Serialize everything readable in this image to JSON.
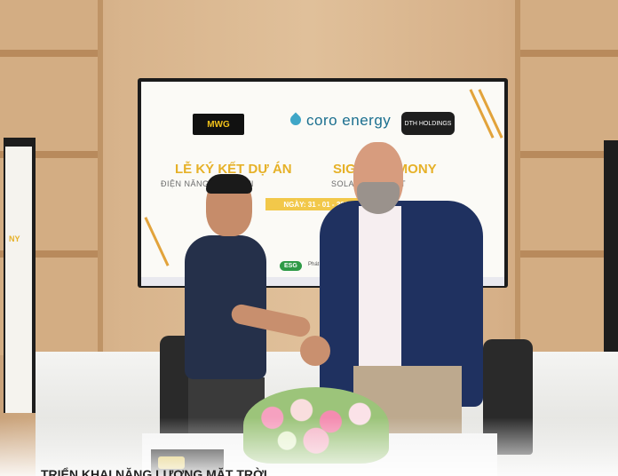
{
  "screen": {
    "logo_mwg": "MWG",
    "logo_coro": "coro energy",
    "logo_dth": "DTH HOLDINGS",
    "title_vn": "LỄ KÝ KẾT DỰ ÁN",
    "subtitle_vn": "ĐIỆN NĂNG    MẶT TRỜI",
    "title_en": "SIG     CEREMONY",
    "subtitle_en": "SOLA     R PROJECT",
    "date": "NGÀY: 31 - 01 - 2024",
    "esg_badge": "ESG",
    "esg_text": "Phát Triển"
  },
  "left_stand": {
    "text": "NY"
  },
  "caption": "TRIỂN KHAI NĂNG LƯỢNG MẶT TRỜI"
}
